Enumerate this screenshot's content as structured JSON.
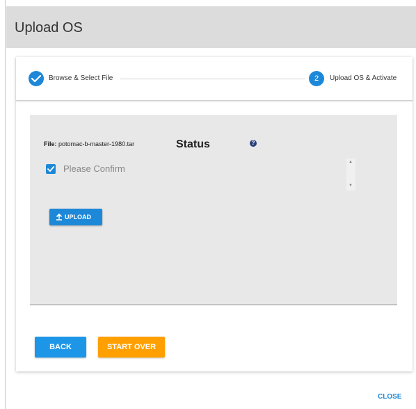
{
  "dialog": {
    "title": "Upload OS"
  },
  "stepper": {
    "steps": [
      {
        "number": "",
        "label": "Browse & Select File",
        "state": "completed"
      },
      {
        "number": "2",
        "label": "Upload OS & Activate",
        "state": "active"
      }
    ]
  },
  "panel": {
    "file_key": "File:",
    "file_name": "potomac-b-master-1980.tar",
    "status_title": "Status",
    "help_icon": "?",
    "confirm_label": "Please Confirm",
    "confirm_checked": true,
    "upload_label": "UPLOAD"
  },
  "actions": {
    "back_label": "BACK",
    "start_over_label": "START OVER",
    "close_label": "CLOSE"
  },
  "colors": {
    "primary": "#1e88d8",
    "warning": "#ffa000",
    "header_bg": "#dcdcdc",
    "panel_bg": "#e8e8e8"
  },
  "icons": {
    "step1": "check-icon",
    "help": "question-circle-icon",
    "checkbox": "check-icon",
    "upload": "upload-icon",
    "scroll_up": "caret-up-icon",
    "scroll_down": "caret-down-icon"
  }
}
